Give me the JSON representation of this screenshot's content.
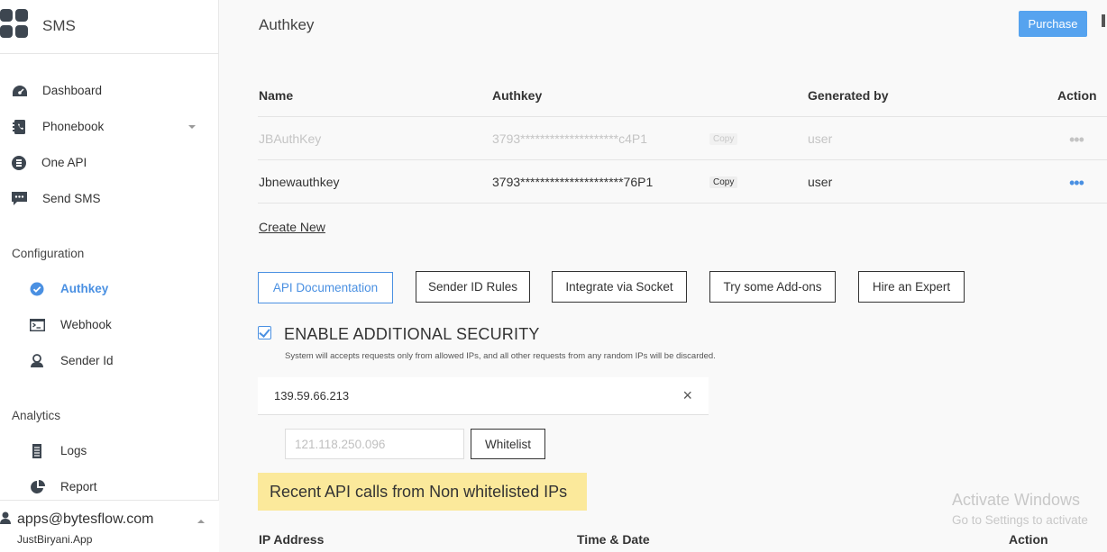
{
  "app": {
    "name": "SMS"
  },
  "sidebar": {
    "main_items": [
      {
        "label": "Dashboard",
        "icon": "dashboard-icon"
      },
      {
        "label": "Phonebook",
        "icon": "phonebook-icon",
        "has_dropdown": true
      },
      {
        "label": "One API",
        "icon": "one-api-icon"
      },
      {
        "label": "Send SMS",
        "icon": "send-sms-icon"
      }
    ],
    "configuration": {
      "title": "Configuration",
      "items": [
        {
          "label": "Authkey",
          "icon": "check-badge-icon",
          "active": true
        },
        {
          "label": "Webhook",
          "icon": "terminal-icon"
        },
        {
          "label": "Sender Id",
          "icon": "user-badge-icon"
        }
      ]
    },
    "analytics": {
      "title": "Analytics",
      "items": [
        {
          "label": "Logs",
          "icon": "logs-icon"
        },
        {
          "label": "Report",
          "icon": "pie-chart-icon"
        }
      ]
    },
    "account": {
      "email": "apps@bytesflow.com",
      "company": "JustBiryani.App"
    }
  },
  "page": {
    "title": "Authkey",
    "purchase_label": "Purchase"
  },
  "authkey_table": {
    "headers": {
      "name": "Name",
      "authkey": "Authkey",
      "generated_by": "Generated by",
      "action": "Action"
    },
    "rows": [
      {
        "name": "JBAuthKey",
        "authkey": "3793********************c4P1",
        "copy": "Copy",
        "generated_by": "user",
        "action": "•••",
        "disabled": true
      },
      {
        "name": "Jbnewauthkey",
        "authkey": "3793*********************76P1",
        "copy": "Copy",
        "generated_by": "user",
        "action": "•••",
        "disabled": false
      }
    ]
  },
  "create_new_label": "Create New",
  "action_buttons": {
    "api_docs": "API Documentation",
    "sender_id_rules": "Sender ID Rules",
    "integrate_socket": "Integrate via Socket",
    "addons": "Try some Add-ons",
    "hire_expert": "Hire an Expert"
  },
  "security": {
    "enabled": true,
    "title": "ENABLE ADDITIONAL SECURITY",
    "description": "System will accepts requests only from allowed IPs, and all other requests from any random IPs will be discarded.",
    "whitelisted_ip": "139.59.66.213",
    "close_glyph": "×",
    "ip_input_placeholder": "121.118.250.096",
    "whitelist_label": "Whitelist"
  },
  "recent_calls": {
    "title": "Recent API calls from Non whitelisted IPs",
    "headers": {
      "ip": "IP Address",
      "time": "Time & Date",
      "action": "Action"
    }
  },
  "watermark": {
    "line1": "Activate Windows",
    "line2": "Go to Settings to activate"
  },
  "colors": {
    "accent": "#4a90e2",
    "purchase": "#56a3ef",
    "highlight": "#fbe99b"
  }
}
